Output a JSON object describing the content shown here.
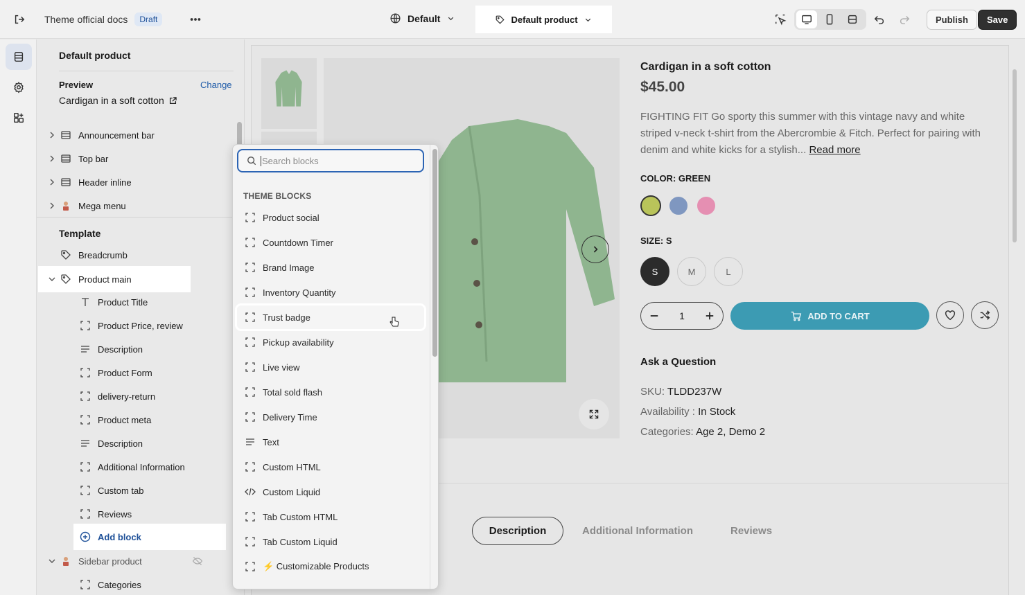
{
  "header": {
    "theme_name": "Theme official docs",
    "status_badge": "Draft",
    "language_selector": "Default",
    "template_selector": "Default product",
    "publish_label": "Publish",
    "save_label": "Save"
  },
  "sidebar": {
    "title": "Default product",
    "preview_label": "Preview",
    "change_label": "Change",
    "preview_value": "Cardigan in a soft cotton",
    "header_sections": [
      {
        "label": "Announcement bar"
      },
      {
        "label": "Top bar"
      },
      {
        "label": "Header inline"
      },
      {
        "label": "Mega menu"
      }
    ],
    "template_label": "Template",
    "breadcrumb_label": "Breadcrumb",
    "product_main_label": "Product main",
    "product_main_blocks": [
      {
        "label": "Product Title",
        "icon": "text-icon"
      },
      {
        "label": "Product Price, review",
        "icon": "block-icon"
      },
      {
        "label": "Description",
        "icon": "lines-icon"
      },
      {
        "label": "Product Form",
        "icon": "block-icon"
      },
      {
        "label": "delivery-return",
        "icon": "block-icon"
      },
      {
        "label": "Product meta",
        "icon": "block-icon"
      },
      {
        "label": "Description",
        "icon": "lines-icon"
      },
      {
        "label": "Additional Information",
        "icon": "block-icon"
      },
      {
        "label": "Custom tab",
        "icon": "block-icon"
      },
      {
        "label": "Reviews",
        "icon": "block-icon"
      }
    ],
    "add_block_label": "Add block",
    "sidebar_product_label": "Sidebar product",
    "categories_label": "Categories"
  },
  "block_picker": {
    "search_placeholder": "Search blocks",
    "section_label": "THEME BLOCKS",
    "items": [
      {
        "label": "Product social",
        "icon": "block-icon"
      },
      {
        "label": "Countdown Timer",
        "icon": "block-icon"
      },
      {
        "label": "Brand Image",
        "icon": "block-icon"
      },
      {
        "label": "Inventory Quantity",
        "icon": "block-icon"
      },
      {
        "label": "Trust badge",
        "icon": "block-icon"
      },
      {
        "label": "Pickup availability",
        "icon": "block-icon"
      },
      {
        "label": "Live view",
        "icon": "block-icon"
      },
      {
        "label": "Total sold flash",
        "icon": "block-icon"
      },
      {
        "label": "Delivery Time",
        "icon": "block-icon"
      },
      {
        "label": "Text",
        "icon": "lines-icon"
      },
      {
        "label": "Custom HTML",
        "icon": "block-icon"
      },
      {
        "label": "Custom Liquid",
        "icon": "code-icon"
      },
      {
        "label": "Tab Custom HTML",
        "icon": "block-icon"
      },
      {
        "label": "Tab Custom Liquid",
        "icon": "block-icon"
      },
      {
        "label": "⚡ Customizable Products",
        "icon": "block-icon"
      }
    ]
  },
  "product": {
    "title": "Cardigan in a soft cotton",
    "price": "$45.00",
    "description": "FIGHTING FIT Go sporty this summer with this vintage navy and white striped v-neck t-shirt from the Abercrombie & Fitch. Perfect for pairing with denim and white kicks for a stylish...",
    "read_more": "Read more",
    "color_label": "COLOR: GREEN",
    "colors": [
      "#b9c45a",
      "#7f97c0",
      "#e58fb2"
    ],
    "size_label": "SIZE: S",
    "sizes": [
      "S",
      "M",
      "L"
    ],
    "quantity": "1",
    "add_to_cart": "ADD TO CART",
    "ask_question": "Ask a Question",
    "sku_label": "SKU:",
    "sku_value": "TLDD237W",
    "availability_label": "Availability :",
    "availability_value": "In Stock",
    "categories_label": "Categories:",
    "categories_value": "Age 2, Demo 2",
    "tabs": [
      "Description",
      "Additional Information",
      "Reviews"
    ]
  }
}
